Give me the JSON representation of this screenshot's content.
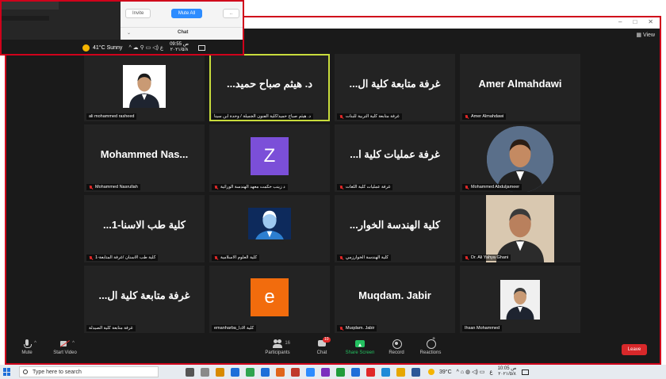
{
  "inset": {
    "invite_label": "Invite",
    "mute_all_label": "Mute All",
    "more_label": "..",
    "chat_label": "Chat",
    "weather": "41°C  Sunny",
    "tray_text": "^ ☁ ⚲ ▭ ◁) ع",
    "time": "09:55 ص",
    "date": "٢٠٢١/٥/٨"
  },
  "zoom": {
    "window_controls": [
      "–",
      "□",
      "✕"
    ],
    "view_label": "View",
    "tiles": [
      {
        "name": "",
        "caption": "ali mohammed rasheed",
        "muted": false,
        "type": "photo1"
      },
      {
        "name": "د. هيثم صباح حميد...",
        "caption": "د. هيثم صباح حميد/كلية الفنون الجميلة / وحدة ابن سينا",
        "muted": false,
        "type": "text",
        "speaking": true
      },
      {
        "name": "غرفة متابعة كلية ال...",
        "caption": "غرفة متابعة كلية التربية للبنات",
        "muted": true,
        "type": "text"
      },
      {
        "name": "Amer Almahdawi",
        "caption": "Amer Almahdawi",
        "muted": true,
        "type": "text"
      },
      {
        "name": "Mohammed  Nas...",
        "caption": "Mohammed Nasrullah",
        "muted": true,
        "type": "text"
      },
      {
        "name": "",
        "caption": "د زينب حكمت معهد الهندسة الوراثية",
        "muted": true,
        "type": "letter",
        "letter": "Z",
        "color": "#7b4fd8"
      },
      {
        "name": "غرفة عمليات كلية ا...",
        "caption": "غرفة عمليات كلية اللغات",
        "muted": true,
        "type": "text"
      },
      {
        "name": "",
        "caption": "Mohammed Abduljameer",
        "muted": true,
        "type": "photo2"
      },
      {
        "name": "كلية طب الاسنا-1...",
        "caption": "كلية طب الاسنان /غرفة المتابعة-1",
        "muted": true,
        "type": "text"
      },
      {
        "name": "",
        "caption": "كلية العلوم الاسلامية",
        "muted": true,
        "type": "photo3"
      },
      {
        "name": "كلية الهندسة الخوار...",
        "caption": "كلية الهندسة الخوارزمي",
        "muted": true,
        "type": "text"
      },
      {
        "name": "",
        "caption": "Dr. Ali Yahya Ghani",
        "muted": true,
        "type": "photo4"
      },
      {
        "name": "غرفة متابعة كلية ال...",
        "caption": "غرفة متابعة كلية الصيدلة",
        "muted": false,
        "type": "text"
      },
      {
        "name": "",
        "caption": "emanharba_كلية الادا",
        "muted": false,
        "type": "letter",
        "letter": "e",
        "color": "#f26c0d"
      },
      {
        "name": "Muqdam. Jabir",
        "caption": "Muqdam. Jabir",
        "muted": true,
        "type": "text"
      },
      {
        "name": "",
        "caption": "Ihsan Mohammed",
        "muted": false,
        "type": "photo5"
      }
    ],
    "controls": {
      "mute": "Mute",
      "start_video": "Start Video",
      "participants": "Participants",
      "participants_count": "16",
      "chat": "Chat",
      "chat_badge": "10",
      "share_screen": "Share Screen",
      "record": "Record",
      "reactions": "Reactions",
      "leave": "Leave"
    }
  },
  "taskbar": {
    "search_placeholder": "Type here to search",
    "weather": "39°C",
    "time": "10:05 ص",
    "date": "٢٠٢١/٥/٨",
    "lang": "ع",
    "app_colors": [
      "#555555",
      "#8a8a8a",
      "#d88a00",
      "#1e6fd9",
      "#2ea44f",
      "#1e6fd9",
      "#e0651b",
      "#c0392b",
      "#2d8cff",
      "#7b2fbe",
      "#1f9c3a",
      "#1e6fd9",
      "#e02828",
      "#1e8bd8",
      "#e6a700",
      "#2b5797"
    ]
  }
}
